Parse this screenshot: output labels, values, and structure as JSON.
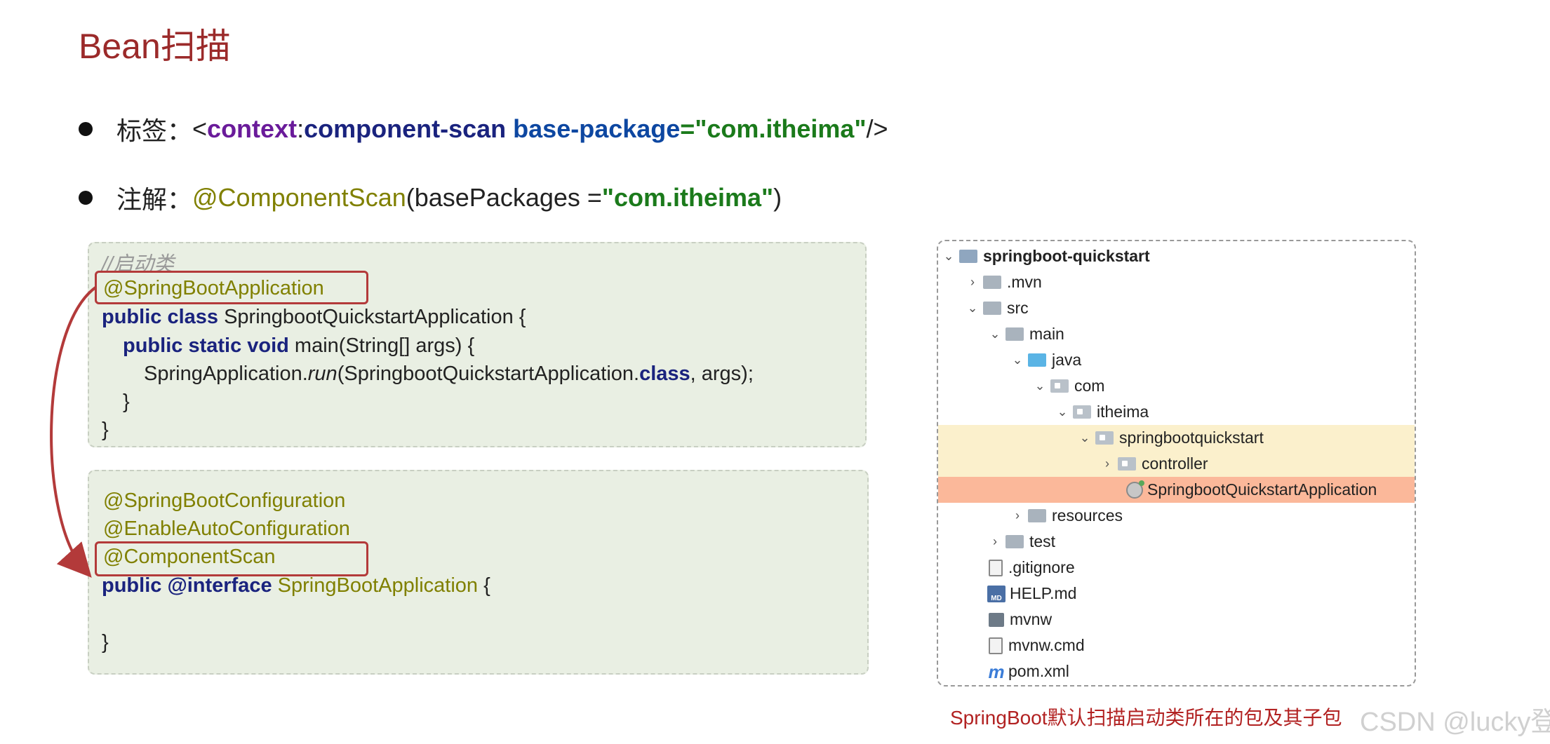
{
  "title": "Bean扫描",
  "bullets": {
    "tag": {
      "label": "标签：",
      "lt": "<",
      "ns": "context",
      "colon": ":",
      "element": "component-scan",
      "attr": "base-package",
      "eq": "=",
      "value": "\"com.itheima\"",
      "close": "/>"
    },
    "annotation": {
      "label": "注解：",
      "name": "@ComponentScan",
      "open": "(basePackages = ",
      "value": "\"com.itheima\"",
      "close": ")"
    }
  },
  "code1": {
    "comment": "//启动类",
    "annotation": "@SpringBootApplication",
    "l2_kw": "public class",
    "l2_rest": " SpringbootQuickstartApplication {",
    "l3_kw": "public static void",
    "l3_rest": " main(String[] args) {",
    "l4_a": "SpringApplication.",
    "l4_run": "run",
    "l4_b": "(SpringbootQuickstartApplication.",
    "l4_class": "class",
    "l4_c": ", args);",
    "l5": "}",
    "l6": "}"
  },
  "code2": {
    "a1": "@SpringBootConfiguration",
    "a2": "@EnableAutoConfiguration",
    "a3": "@ComponentScan",
    "l4_kw": "public @interface",
    "l4_name": " SpringBootApplication",
    "l4_brace": " {",
    "l5": "}"
  },
  "tree": {
    "root": "springboot-quickstart",
    "mvn": ".mvn",
    "src": "src",
    "main": "main",
    "java": "java",
    "com": "com",
    "itheima": "itheima",
    "springbootquickstart": "springbootquickstart",
    "controller": "controller",
    "app": "SpringbootQuickstartApplication",
    "resources": "resources",
    "test": "test",
    "gitignore": ".gitignore",
    "help": "HELP.md",
    "mvnw": "mvnw",
    "mvnwcmd": "mvnw.cmd",
    "pom": "pom.xml",
    "md_badge": "MD",
    "m_glyph": "m"
  },
  "caption": "SpringBoot默认扫描启动类所在的包及其子包",
  "watermark": "CSDN @lucky登",
  "colors": {
    "title": "#9b2a2a",
    "highlight_border": "#b33a3a",
    "selected_package": "#fbf0cc",
    "selected_class": "#fbb89a"
  }
}
